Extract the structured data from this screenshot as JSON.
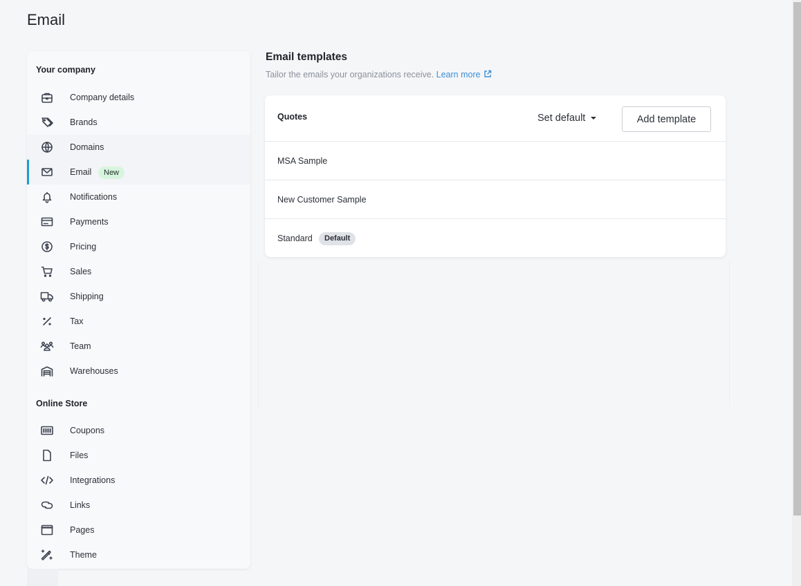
{
  "page": {
    "title": "Email"
  },
  "sidebar": {
    "sections": [
      {
        "title": "Your company",
        "items": [
          {
            "label": "Company details",
            "icon": "briefcase-icon"
          },
          {
            "label": "Brands",
            "icon": "tags-icon"
          },
          {
            "label": "Domains",
            "icon": "globe-icon"
          },
          {
            "label": "Email",
            "icon": "mail-icon",
            "badge": "New",
            "active": true
          },
          {
            "label": "Notifications",
            "icon": "bell-icon"
          },
          {
            "label": "Payments",
            "icon": "credit-card-icon"
          },
          {
            "label": "Pricing",
            "icon": "dollar-circle-icon"
          },
          {
            "label": "Sales",
            "icon": "cart-icon"
          },
          {
            "label": "Shipping",
            "icon": "truck-icon"
          },
          {
            "label": "Tax",
            "icon": "percent-icon"
          },
          {
            "label": "Team",
            "icon": "team-icon"
          },
          {
            "label": "Warehouses",
            "icon": "warehouse-icon"
          }
        ]
      },
      {
        "title": "Online Store",
        "items": [
          {
            "label": "Coupons",
            "icon": "barcode-icon"
          },
          {
            "label": "Files",
            "icon": "file-icon"
          },
          {
            "label": "Integrations",
            "icon": "code-icon"
          },
          {
            "label": "Links",
            "icon": "link-icon"
          },
          {
            "label": "Pages",
            "icon": "browser-window-icon"
          },
          {
            "label": "Theme",
            "icon": "magic-wand-icon"
          }
        ]
      }
    ]
  },
  "main": {
    "title": "Email templates",
    "subtitle": "Tailor the emails your organizations receive.",
    "learn_more": "Learn more",
    "card": {
      "title": "Quotes",
      "set_default_label": "Set default",
      "add_template_label": "Add template",
      "templates": [
        {
          "name": "MSA Sample"
        },
        {
          "name": "New Customer Sample"
        },
        {
          "name": "Standard",
          "badge": "Default"
        }
      ]
    }
  },
  "colors": {
    "accent": "#1e9ad6",
    "link": "#3a8fd6",
    "new_badge_bg": "#d7f5de",
    "default_badge_bg": "#dfe2e7"
  }
}
